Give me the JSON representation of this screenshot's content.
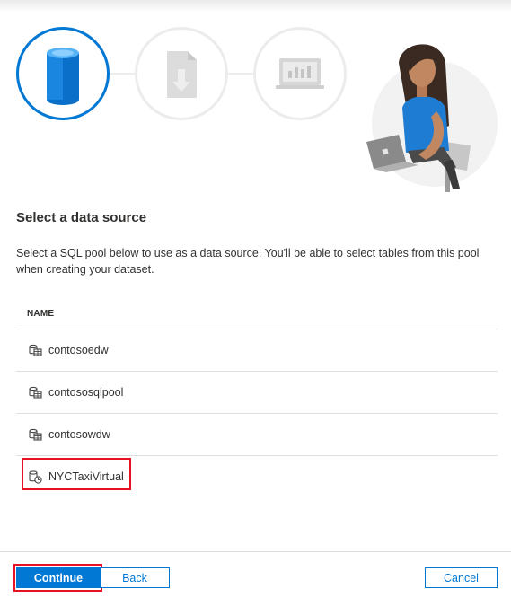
{
  "wizard": {
    "steps": [
      {
        "name": "data source",
        "icon": "database-icon",
        "state": "active"
      },
      {
        "name": "download",
        "icon": "download-document-icon",
        "state": "inactive"
      },
      {
        "name": "report",
        "icon": "report-monitor-icon",
        "state": "inactive"
      }
    ]
  },
  "page": {
    "heading": "Select a data source",
    "description": "Select a SQL pool below to use as a data source. You'll be able to select tables from this pool when creating your dataset."
  },
  "table": {
    "header": "NAME",
    "rows": [
      {
        "name": "contosoedw",
        "icon": "sql-pool-icon"
      },
      {
        "name": "contososqlpool",
        "icon": "sql-pool-icon"
      },
      {
        "name": "contosowdw",
        "icon": "sql-pool-icon"
      },
      {
        "name": "NYCTaxiVirtual",
        "icon": "serverless-sql-icon"
      }
    ]
  },
  "footer": {
    "continue_label": "Continue",
    "back_label": "Back",
    "cancel_label": "Cancel"
  },
  "colors": {
    "accent": "#0078d4",
    "highlight": "#e81123"
  }
}
